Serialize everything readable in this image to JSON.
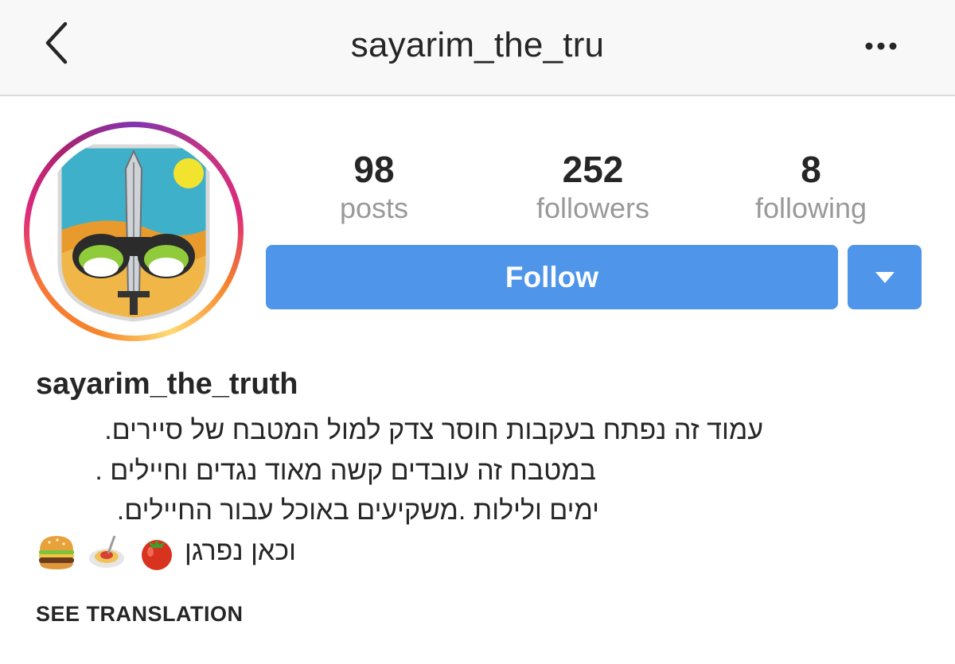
{
  "header": {
    "title": "sayarim_the_tru",
    "back_icon": "chevron-left-icon",
    "more_icon": "more-horizontal-icon"
  },
  "profile": {
    "avatar_icon": "unit-emblem-avatar",
    "stats": [
      {
        "value": "98",
        "label": "posts"
      },
      {
        "value": "252",
        "label": "followers"
      },
      {
        "value": "8",
        "label": "following"
      }
    ],
    "follow_label": "Follow",
    "dropdown_icon": "caret-down-icon",
    "accent_color": "#4f95ea"
  },
  "bio": {
    "name": "sayarim_the_truth",
    "lines": [
      "עמוד זה נפתח בעקבות חוסר צדק למול המטבח של סיירים.",
      "במטבח זה עובדים קשה מאוד נגדים וחיילים .",
      "ימים ולילות .משקיעים באוכל עבור החיילים.",
      "וכאן נפרגן"
    ],
    "emojis": [
      "burger-emoji",
      "spaghetti-emoji",
      "tomato-emoji"
    ],
    "see_translation": "SEE TRANSLATION"
  }
}
